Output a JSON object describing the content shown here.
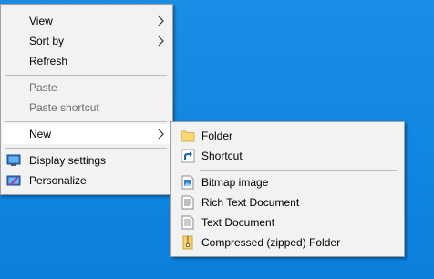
{
  "context_menu": {
    "view_label": "View",
    "sort_by_label": "Sort by",
    "refresh_label": "Refresh",
    "paste_label": "Paste",
    "paste_shortcut_label": "Paste shortcut",
    "new_label": "New",
    "display_settings_label": "Display settings",
    "personalize_label": "Personalize"
  },
  "new_submenu": {
    "folder_label": "Folder",
    "shortcut_label": "Shortcut",
    "bitmap_label": "Bitmap image",
    "rtf_label": "Rich Text Document",
    "text_label": "Text Document",
    "zip_label": "Compressed (zipped) Folder"
  },
  "colors": {
    "desktop": "#0f86e0",
    "menu_bg": "#f2f2f2",
    "highlight": "#ffffff",
    "disabled_text": "#6d6d6d"
  },
  "icons": [
    "display-icon",
    "personalize-icon",
    "folder-icon",
    "shortcut-icon",
    "bitmap-icon",
    "rich-text-icon",
    "text-document-icon",
    "zip-folder-icon"
  ]
}
